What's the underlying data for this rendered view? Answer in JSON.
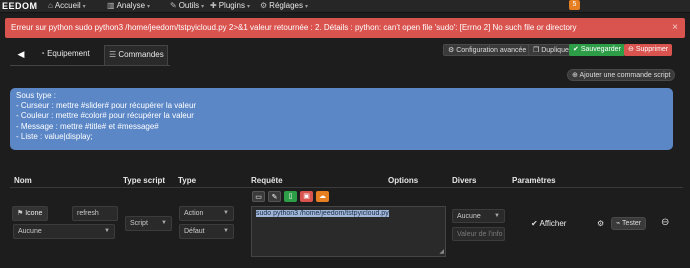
{
  "nav": {
    "brand": "EEDOM",
    "menus": [
      {
        "icon": "home-icon",
        "label": "Accueil"
      },
      {
        "icon": "chart-icon",
        "label": "Analyse"
      },
      {
        "icon": "wrench-icon",
        "label": "Outils"
      },
      {
        "icon": "puzzle-icon",
        "label": "Plugins"
      },
      {
        "icon": "gears-icon",
        "label": "Réglages"
      }
    ],
    "notification_count": "5"
  },
  "alert": {
    "message": "Erreur sur python sudo python3 /home/jeedom/tstpyicloud.py 2>&1 valeur retournée : 2. Détails : python: can't open file 'sudo': [Errno 2] No such file or directory",
    "close": "×"
  },
  "tabs": {
    "back_icon": "arrow-circle-left-icon",
    "equipement": "Equipement",
    "commandes": "Commandes"
  },
  "actions": {
    "config_avancee": "Configuration avancée",
    "dupliquer": "Dupliquer",
    "sauvegarder": "Sauvegarder",
    "supprimer": "Supprimer",
    "ajouter_commande": "Ajouter une commande script"
  },
  "info": {
    "lines": [
      "Sous type :",
      "- Curseur : mettre #slider# pour récupérer la valeur",
      "- Couleur : mettre #color# pour récupérer la valeur",
      "- Message : mettre #title# et #message#",
      "- Liste : value|display;"
    ]
  },
  "table": {
    "headers": [
      "Nom",
      "Type script",
      "Type",
      "Requête",
      "Options",
      "Divers",
      "Paramètres"
    ],
    "row": {
      "icon_button": "Icone",
      "name": "refresh",
      "aucune_1": "Aucune",
      "script_type": "Script",
      "type": "Action",
      "subtype": "Défaut",
      "request": "sudo python3 /home/jeedom/tstpyicloud.py",
      "divers_select": "Aucune",
      "divers_placeholder": "Valeur de l'info",
      "afficher": "Afficher",
      "tester": "Tester"
    }
  },
  "colors": {
    "alert": "#d9534f",
    "info": "#5b87c7",
    "save": "#2e9d47",
    "delete": "#d9534f",
    "accent_orange": "#e67e22"
  }
}
